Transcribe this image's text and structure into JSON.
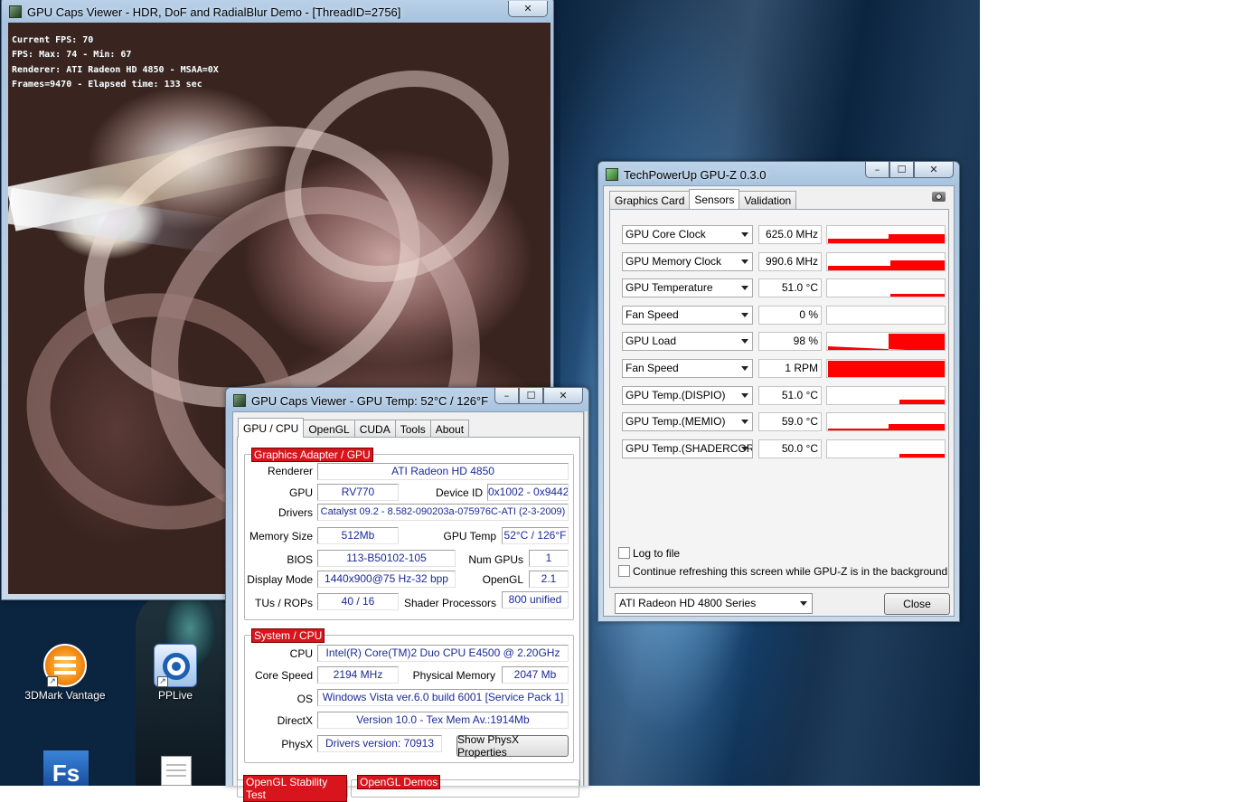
{
  "desktop": {
    "icons": [
      {
        "label": "3DMark Vantage",
        "icon": "3dmark-icon"
      },
      {
        "label": "PPLive",
        "icon": "pplive-icon"
      },
      {
        "label": "",
        "icon": "fs-app-icon"
      },
      {
        "label": "",
        "icon": "document-icon"
      }
    ],
    "fs_glyph": "Fs"
  },
  "demo_window": {
    "title": "GPU Caps Viewer - HDR, DoF and RadialBlur Demo - [ThreadID=2756]",
    "close_glyph": "✕",
    "hud": [
      "Current FPS: 70",
      "FPS: Max: 74 - Min: 67",
      "Renderer: ATI Radeon HD 4850 - MSAA=0X",
      "Frames=9470 - Elapsed time: 133 sec"
    ]
  },
  "caps_window": {
    "title": "GPU Caps Viewer - GPU Temp: 52°C / 126°F",
    "caption": {
      "min": "–",
      "max": "☐",
      "close": "✕"
    },
    "tabs": [
      "GPU / CPU",
      "OpenGL",
      "CUDA",
      "Tools",
      "About"
    ],
    "graphics": {
      "title": "Graphics Adapter / GPU",
      "renderer_label": "Renderer",
      "renderer": "ATI Radeon HD 4850",
      "gpu_label": "GPU",
      "gpu": "RV770",
      "device_id_label": "Device ID",
      "device_id": "0x1002 - 0x9442",
      "drivers_label": "Drivers",
      "drivers": "Catalyst 09.2 - 8.582-090203a-075976C-ATI (2-3-2009)",
      "memory_label": "Memory Size",
      "memory": "512Mb",
      "gpu_temp_label": "GPU Temp",
      "gpu_temp": "52°C / 126°F",
      "bios_label": "BIOS",
      "bios": "113-B50102-105",
      "num_gpus_label": "Num GPUs",
      "num_gpus": "1",
      "display_mode_label": "Display Mode",
      "display_mode": "1440x900@75 Hz-32 bpp",
      "opengl_label": "OpenGL",
      "opengl": "2.1",
      "tus_label": "TUs / ROPs",
      "tus": "40 / 16",
      "shader_label": "Shader Processors",
      "shader": "800 unified"
    },
    "system": {
      "title": "System / CPU",
      "cpu_label": "CPU",
      "cpu": "Intel(R) Core(TM)2 Duo CPU     E4500  @ 2.20GHz",
      "core_speed_label": "Core Speed",
      "core_speed": "2194 MHz",
      "phys_mem_label": "Physical Memory",
      "phys_mem": "2047 Mb",
      "os_label": "OS",
      "os": "Windows Vista ver.6.0 build 6001 [Service Pack 1]",
      "directx_label": "DirectX",
      "directx": "Version 10.0 - Tex Mem Av.:1914Mb",
      "physx_label": "PhysX",
      "physx": "Drivers version: 70913",
      "physx_button": "Show PhysX Properties"
    },
    "bottom_groups": [
      "OpenGL Stability Test",
      "OpenGL Demos"
    ]
  },
  "gpuz_window": {
    "title": "TechPowerUp GPU-Z 0.3.0",
    "caption": {
      "min": "–",
      "max": "☐",
      "close": "✕"
    },
    "tabs": [
      "Graphics Card",
      "Sensors",
      "Validation"
    ],
    "sensors": [
      {
        "name": "GPU Core Clock",
        "value": "625.0 MHz"
      },
      {
        "name": "GPU Memory Clock",
        "value": "990.6 MHz"
      },
      {
        "name": "GPU Temperature",
        "value": "51.0 °C"
      },
      {
        "name": "Fan Speed",
        "value": "0 %"
      },
      {
        "name": "GPU Load",
        "value": "98 %"
      },
      {
        "name": "Fan Speed",
        "value": "1 RPM"
      },
      {
        "name": "GPU Temp.(DISPIO)",
        "value": "51.0 °C"
      },
      {
        "name": "GPU Temp.(MEMIO)",
        "value": "59.0 °C"
      },
      {
        "name": "GPU Temp.(SHADERCORE)",
        "value": "50.0 °C"
      }
    ],
    "log_to_file": "Log to file",
    "continue_refresh": "Continue refreshing this screen while GPU-Z is in the background",
    "card_select": "ATI Radeon HD 4800 Series",
    "close_button": "Close",
    "graph_color": "#ff0000"
  }
}
